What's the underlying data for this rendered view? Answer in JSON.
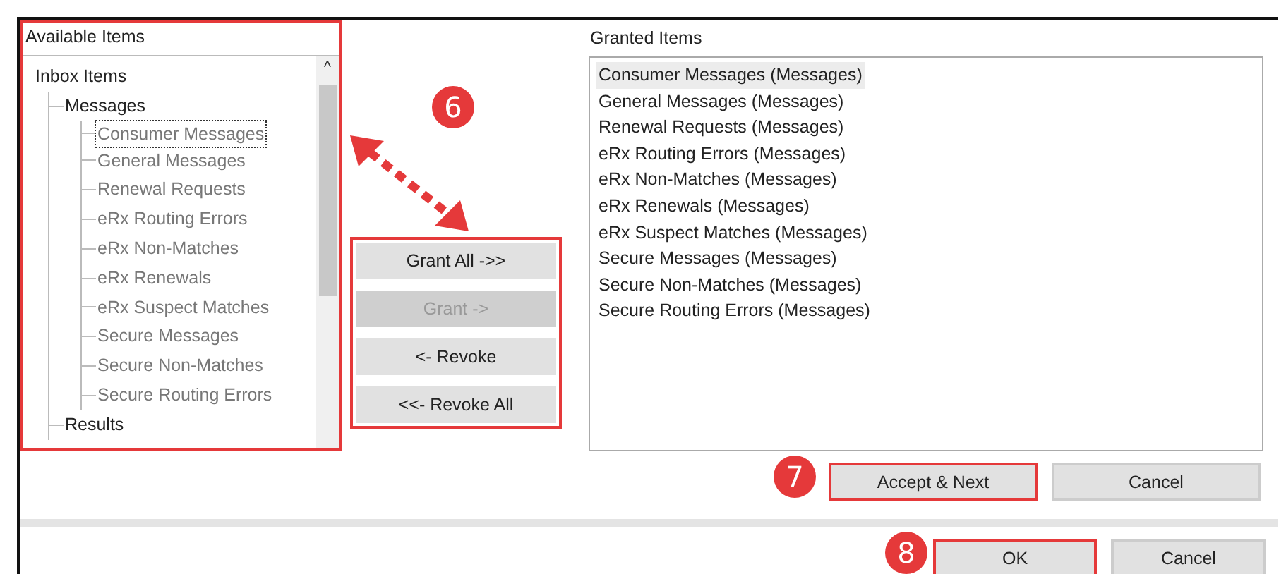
{
  "available": {
    "title": "Available Items",
    "highlighted": true,
    "tree": [
      {
        "label": "Inbox Items",
        "greyed": false,
        "focused": false,
        "children": [
          {
            "label": "Messages",
            "greyed": false,
            "focused": false,
            "children": [
              {
                "label": "Consumer Messages",
                "greyed": true,
                "focused": true
              },
              {
                "label": "General Messages",
                "greyed": true,
                "focused": false
              },
              {
                "label": "Renewal Requests",
                "greyed": true,
                "focused": false
              },
              {
                "label": "eRx Routing Errors",
                "greyed": true,
                "focused": false
              },
              {
                "label": "eRx Non-Matches",
                "greyed": true,
                "focused": false
              },
              {
                "label": "eRx Renewals",
                "greyed": true,
                "focused": false
              },
              {
                "label": "eRx Suspect Matches",
                "greyed": true,
                "focused": false
              },
              {
                "label": "Secure Messages",
                "greyed": true,
                "focused": false
              },
              {
                "label": "Secure Non-Matches",
                "greyed": true,
                "focused": false
              },
              {
                "label": "Secure Routing Errors",
                "greyed": true,
                "focused": false
              }
            ]
          },
          {
            "label": "Results",
            "greyed": false,
            "focused": false
          }
        ]
      }
    ],
    "scroll_up": "^"
  },
  "transfer": {
    "highlighted": true,
    "buttons": [
      {
        "label": "Grant All ->>",
        "disabled": false
      },
      {
        "label": "Grant ->",
        "disabled": true
      },
      {
        "label": "<- Revoke",
        "disabled": false
      },
      {
        "label": "<<- Revoke All",
        "disabled": false
      }
    ]
  },
  "granted": {
    "title": "Granted Items",
    "items": [
      {
        "label": "Consumer Messages (Messages)",
        "selected": true
      },
      {
        "label": "General Messages (Messages)",
        "selected": false
      },
      {
        "label": "Renewal Requests (Messages)",
        "selected": false
      },
      {
        "label": "eRx Routing Errors (Messages)",
        "selected": false
      },
      {
        "label": "eRx Non-Matches (Messages)",
        "selected": false
      },
      {
        "label": "eRx Renewals (Messages)",
        "selected": false
      },
      {
        "label": "eRx Suspect Matches (Messages)",
        "selected": false
      },
      {
        "label": "Secure Messages (Messages)",
        "selected": false
      },
      {
        "label": "Secure Non-Matches (Messages)",
        "selected": false
      },
      {
        "label": "Secure Routing Errors (Messages)",
        "selected": false
      }
    ]
  },
  "step_buttons": [
    {
      "label": "Accept & Next",
      "highlighted": true
    },
    {
      "label": "Cancel",
      "highlighted": false
    }
  ],
  "dialog_buttons": [
    {
      "label": "OK",
      "highlighted": true
    },
    {
      "label": "Cancel",
      "highlighted": false
    }
  ],
  "callouts": [
    "6",
    "7",
    "8"
  ]
}
